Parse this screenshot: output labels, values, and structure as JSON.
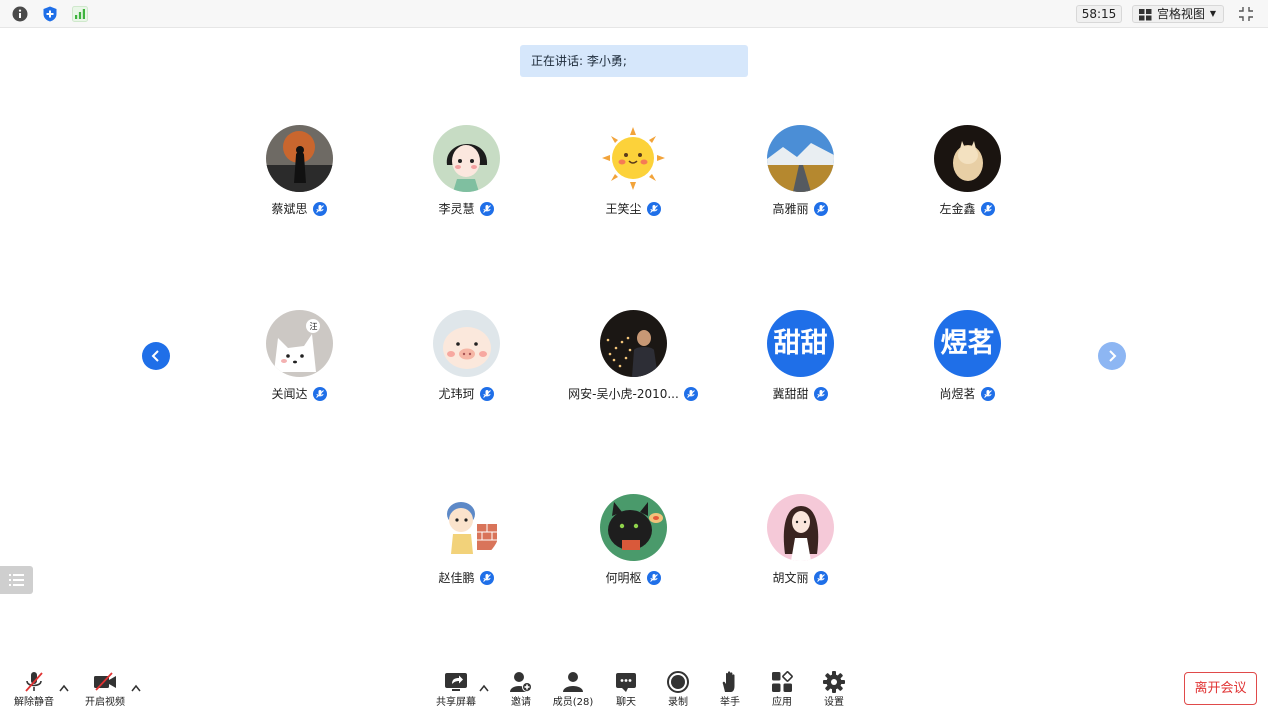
{
  "top_bar": {
    "timer": "58:15",
    "view_mode": "宫格视图"
  },
  "speaking": {
    "label": "正在讲话:",
    "speaker": "李小勇;"
  },
  "participants": [
    {
      "name": "蔡斌思",
      "avatar": "photo-silhouette-sunset"
    },
    {
      "name": "李灵慧",
      "avatar": "cartoon-girl"
    },
    {
      "name": "王笑尘",
      "avatar": "sun-cartoon"
    },
    {
      "name": "高雅丽",
      "avatar": "mountain-road-photo"
    },
    {
      "name": "左金鑫",
      "avatar": "cat-photo"
    },
    {
      "name": "关闻达",
      "avatar": "cartoon-dog"
    },
    {
      "name": "尤玮珂",
      "avatar": "cartoon-pig"
    },
    {
      "name": "网安-吴小虎-2010...",
      "avatar": "person-lights-photo"
    },
    {
      "name": "冀甜甜",
      "avatar_text": "甜甜"
    },
    {
      "name": "尚煜茗",
      "avatar_text": "煜茗"
    },
    {
      "name": "赵佳鹏",
      "avatar": "cartoon-boy-bricks"
    },
    {
      "name": "何明枢",
      "avatar": "cartoon-black-cat"
    },
    {
      "name": "胡文丽",
      "avatar": "illustration-girl-pink"
    }
  ],
  "toolbar": {
    "unmute": "解除静音",
    "start_video": "开启视频",
    "share_screen": "共享屏幕",
    "invite": "邀请",
    "members": "成员(28)",
    "chat": "聊天",
    "record": "录制",
    "raise_hand": "举手",
    "apps": "应用",
    "settings": "设置",
    "leave": "离开会议"
  },
  "colors": {
    "accent": "#1f6fe8",
    "speaking_bg": "#d6e7fb",
    "leave": "#e03333"
  }
}
